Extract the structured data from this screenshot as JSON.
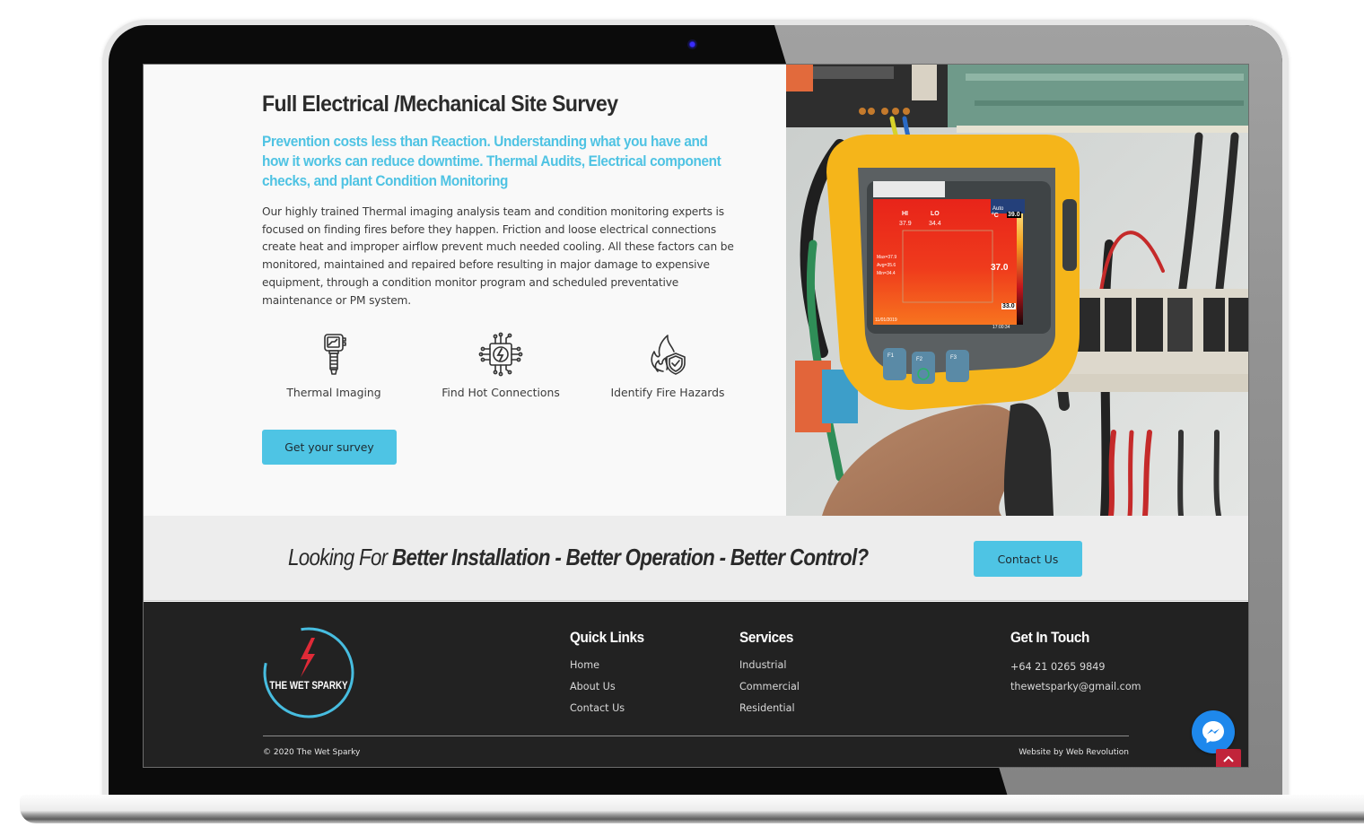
{
  "hero": {
    "title": "Full Electrical /Mechanical Site Survey",
    "subtitle": "Prevention costs less than Reaction. Understanding what you have and how it works can reduce downtime. Thermal Audits, Electrical component checks, and plant Condition Monitoring",
    "body": "Our highly trained Thermal imaging analysis team and condition monitoring experts is focused on finding fires before they happen. Friction and loose electrical connections create heat and improper airflow prevent much needed cooling. All these factors can be monitored, maintained and repaired before resulting in major damage to expensive equipment, through a condition monitor program and scheduled preventative maintenance or PM system.",
    "features": [
      {
        "icon": "thermal-camera-icon",
        "label": "Thermal Imaging"
      },
      {
        "icon": "circuit-lightning-icon",
        "label": "Find Hot Connections"
      },
      {
        "icon": "fire-shield-icon",
        "label": "Identify Fire Hazards"
      }
    ],
    "cta_label": "Get your survey"
  },
  "photo": {
    "subject": "hand holding thermal imaging camera in front of electrical panel",
    "screen": {
      "hi_label": "HI",
      "hi_value": "37.9",
      "lo_label": "LO",
      "lo_value": "34.4",
      "mode": "Auto",
      "unit": "°C",
      "max_scale": "39.0",
      "min_scale": "33.0",
      "spot_value": "37.0",
      "stats": [
        "Max=37.9",
        "Avg=35.6",
        "Min=34.4"
      ],
      "date": "11/01/2019",
      "time": "17:00:34"
    },
    "buttons": [
      "F1",
      "F2",
      "F3"
    ]
  },
  "cta_banner": {
    "prefix": "Looking For ",
    "highlight": "Better Installation - Better Operation - Better Control?",
    "button_label": "Contact Us"
  },
  "footer": {
    "logo_text": "THE WET SPARKY",
    "quick_links": {
      "title": "Quick Links",
      "items": [
        "Home",
        "About Us",
        "Contact Us"
      ]
    },
    "services": {
      "title": "Services",
      "items": [
        "Industrial",
        "Commercial",
        "Residential"
      ]
    },
    "contact": {
      "title": "Get In Touch",
      "phone": "+64 21 0265 9849",
      "email": "thewetsparky@gmail.com"
    },
    "copyright": "© 2020 The Wet Sparky",
    "credit": "Website by Web Revolution"
  },
  "floating": {
    "messenger_icon": "messenger-icon",
    "back_to_top_icon": "chevron-up-icon"
  },
  "colors": {
    "accent": "#4ec4e4",
    "footer_bg": "#222222",
    "cta_bg": "#ededed",
    "logo_red": "#e02a37",
    "messenger_blue": "#1e88ec",
    "back_to_top": "#c1243a"
  }
}
